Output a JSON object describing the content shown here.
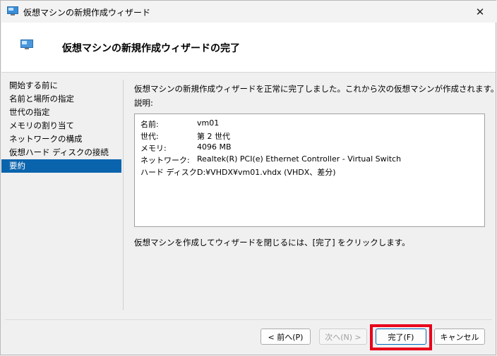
{
  "window": {
    "title": "仮想マシンの新規作成ウィザード"
  },
  "header": {
    "title": "仮想マシンの新規作成ウィザードの完了"
  },
  "nav": {
    "items": [
      {
        "label": "開始する前に"
      },
      {
        "label": "名前と場所の指定"
      },
      {
        "label": "世代の指定"
      },
      {
        "label": "メモリの割り当て"
      },
      {
        "label": "ネットワークの構成"
      },
      {
        "label": "仮想ハード ディスクの接続"
      },
      {
        "label": "要約",
        "selected": true
      }
    ]
  },
  "main": {
    "intro": "仮想マシンの新規作成ウィザードを正常に完了しました。これから次の仮想マシンが作成されます。",
    "description_label": "説明:",
    "summary": [
      {
        "key": "名前:",
        "value": "vm01"
      },
      {
        "key": "世代:",
        "value": "第 2 世代"
      },
      {
        "key": "メモリ:",
        "value": "4096 MB"
      },
      {
        "key": "ネットワーク:",
        "value": "Realtek(R) PCI(e) Ethernet Controller - Virtual Switch"
      },
      {
        "key": "ハード ディスク:",
        "value": "D:¥VHDX¥vm01.vhdx (VHDX、差分)"
      }
    ],
    "finish_text": "仮想マシンを作成してウィザードを閉じるには、[完了] をクリックします。"
  },
  "buttons": {
    "back": "< 前へ(P)",
    "next": "次へ(N) >",
    "finish": "完了(F)",
    "cancel": "キャンセル"
  },
  "colors": {
    "selection": "#0a64ad",
    "highlight": "#e8001c",
    "accent": "#0067c0"
  },
  "icons": {
    "window": "monitor-icon",
    "close": "close-icon"
  }
}
